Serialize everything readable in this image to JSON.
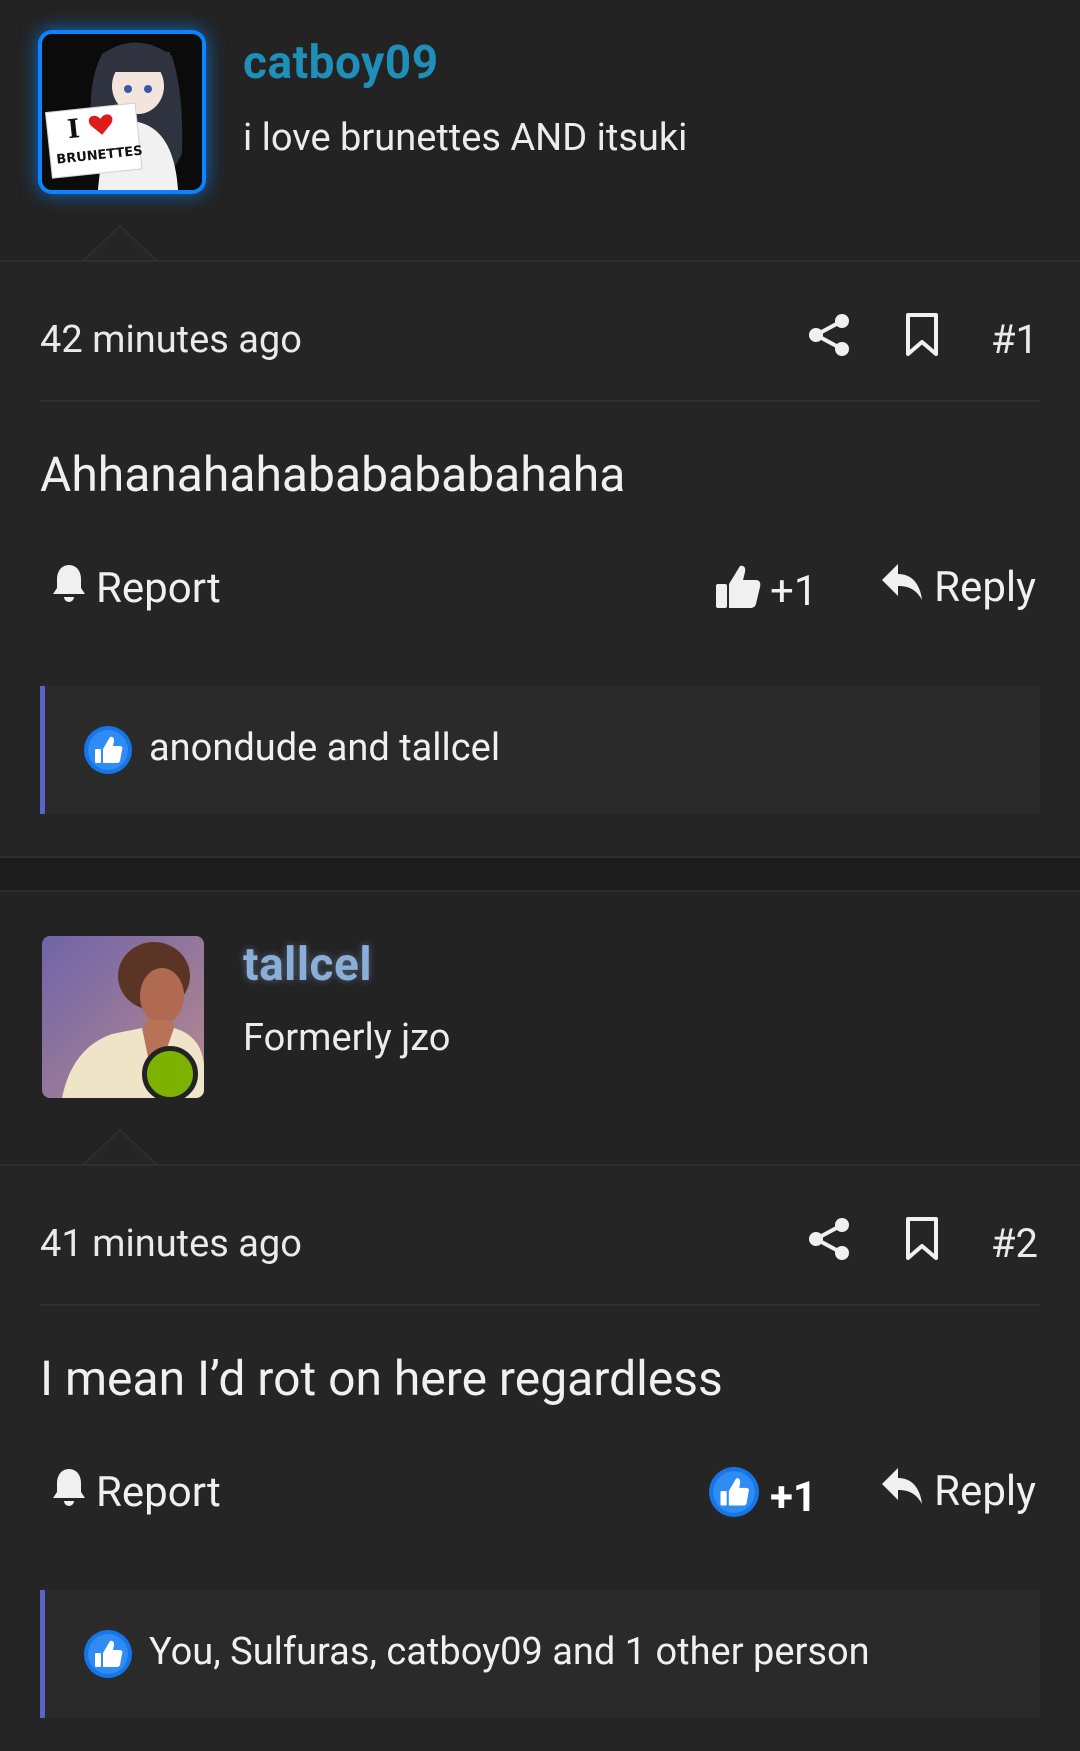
{
  "posts": [
    {
      "username": "catboy09",
      "username_color": "#1e8fb8",
      "user_title": "i love brunettes AND itsuki",
      "avatar_sign_line1": "I",
      "avatar_sign_line2": "BRUNETTES",
      "time": "42 minutes ago",
      "post_number": "#1",
      "message": "Ahhanahahababababahaha",
      "report_label": "Report",
      "like_label": "+1",
      "reply_label": "Reply",
      "reactions_text": "anondude and tallcel",
      "liked_by_me": false
    },
    {
      "username": "tallcel",
      "username_color": "#8aaed8",
      "user_title": "Formerly jzo",
      "online": true,
      "time": "41 minutes ago",
      "post_number": "#2",
      "message": "I mean I’d rot on here regardless",
      "report_label": "Report",
      "like_label": "+1",
      "reply_label": "Reply",
      "reactions_text": "You, Sulfuras, catboy09 and 1 other person",
      "liked_by_me": true
    }
  ]
}
